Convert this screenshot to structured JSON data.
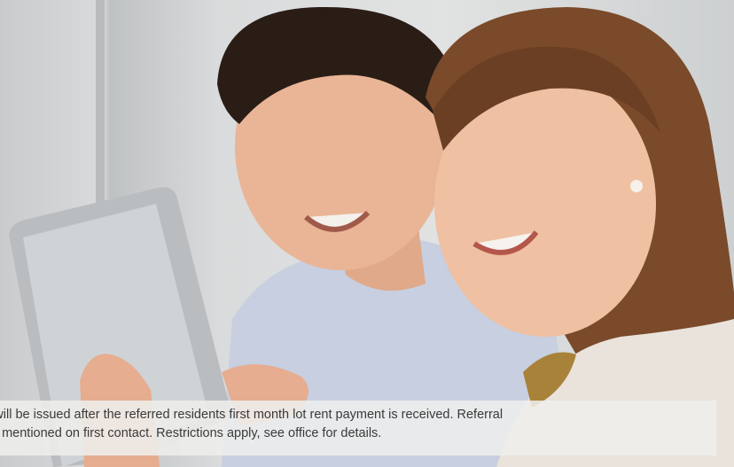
{
  "photo": {
    "icon": "couple-with-tablet-photo"
  },
  "caption": {
    "line1": "s will be issued after the referred residents first month lot rent payment is received. Referral",
    "line2": "e mentioned on first contact. Restrictions apply, see office for details."
  },
  "colors": {
    "caption_background": "#eeeeec",
    "caption_text": "#3a3a3a"
  }
}
